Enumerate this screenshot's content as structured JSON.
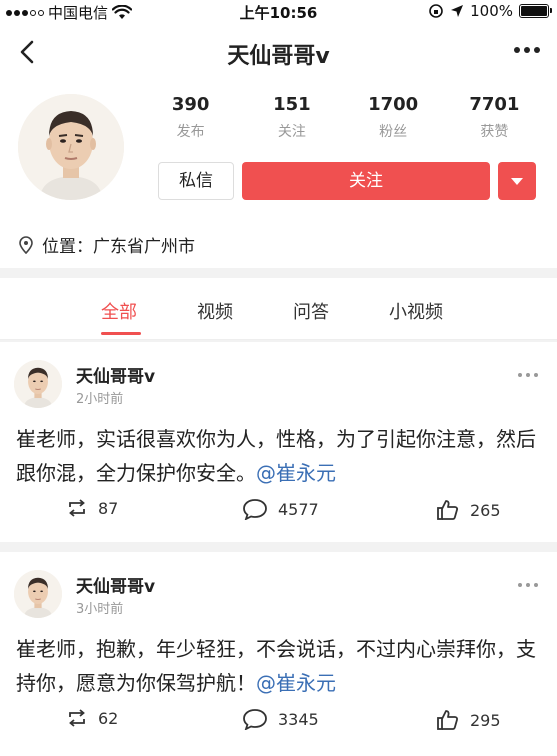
{
  "status_bar": {
    "carrier": "中国电信",
    "time": "上午10:56",
    "battery": "100%",
    "battery_level": 1.0
  },
  "nav": {
    "title": "天仙哥哥v"
  },
  "profile": {
    "stats": [
      {
        "value": "390",
        "label": "发布"
      },
      {
        "value": "151",
        "label": "关注"
      },
      {
        "value": "1700",
        "label": "粉丝"
      },
      {
        "value": "7701",
        "label": "获赞"
      }
    ],
    "message_label": "私信",
    "follow_label": "关注",
    "location": "位置：广东省广州市"
  },
  "tabs": [
    {
      "label": "全部",
      "active": true
    },
    {
      "label": "视频",
      "active": false
    },
    {
      "label": "问答",
      "active": false
    },
    {
      "label": "小视频",
      "active": false
    }
  ],
  "posts": [
    {
      "author": "天仙哥哥v",
      "time": "2小时前",
      "text": "崔老师，实话很喜欢你为人，性格，为了引起你注意，然后跟你混，全力保护你安全。",
      "mention": "@崔永元",
      "reposts": "87",
      "comments": "4577",
      "likes": "265"
    },
    {
      "author": "天仙哥哥v",
      "time": "3小时前",
      "text": "崔老师，抱歉，年少轻狂，不会说话，不过内心崇拜你，支持你，愿意为你保驾护航！",
      "mention": "@崔永元",
      "reposts": "62",
      "comments": "3345",
      "likes": "295"
    }
  ],
  "icons": {
    "back": "back-arrow-icon",
    "more": "more-icon",
    "location": "location-pin-icon",
    "repost": "repost-icon",
    "comment": "comment-icon",
    "like": "thumbs-up-icon",
    "wifi": "wifi-icon"
  },
  "colors": {
    "accent": "#f05050",
    "mention": "#3b6fb5",
    "muted": "#999999"
  }
}
